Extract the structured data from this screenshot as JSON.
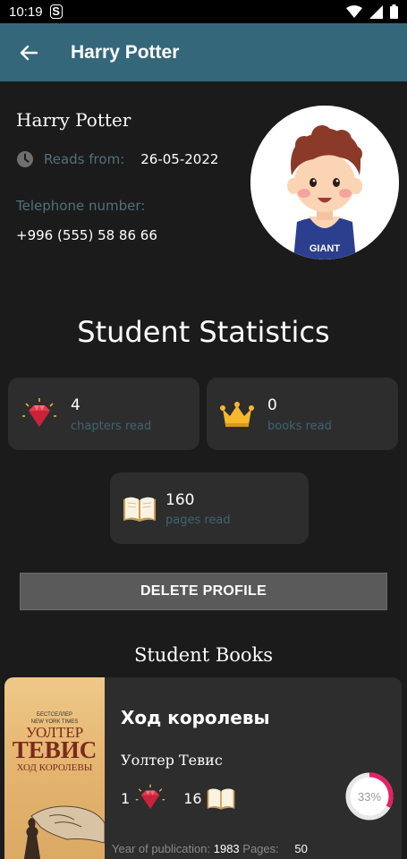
{
  "status_bar": {
    "time": "10:19",
    "sim_icon": "sim-icon",
    "icons": [
      "wifi-icon",
      "signal-icon",
      "battery-icon"
    ]
  },
  "app_bar": {
    "title": "Harry Potter",
    "background": "#35677a"
  },
  "profile": {
    "name": "Harry Potter",
    "reads_from_label": "Reads from:",
    "reads_from_value": "26-05-2022",
    "telephone_label": "Telephone number:",
    "telephone_value": "+996 (555) 58 86 66"
  },
  "stats": {
    "title": "Student Statistics",
    "cards": [
      {
        "value": "4",
        "label": "chapters read",
        "icon": "gem-icon"
      },
      {
        "value": "0",
        "label": "books read",
        "icon": "crown-icon"
      },
      {
        "value": "160",
        "label": "pages read",
        "icon": "open-book-icon"
      }
    ]
  },
  "delete_button": "DELETE PROFILE",
  "books": {
    "title": "Student Books",
    "items": [
      {
        "cover": {
          "small": "БЕСТСЕЛЛЕР\nNEW YORK TIMES",
          "author": "УОЛТЕР",
          "title": "ТЕВИС",
          "subtitle": "ХОД КОРОЛЕВЫ"
        },
        "title": "Ход королевы",
        "author": "Уолтер Тевис",
        "chapters": "1",
        "pages": "16",
        "progress_text": "33%",
        "progress": 0.33,
        "progress_color": "#e91e63",
        "year_label": "Year of publication:",
        "year": "1983",
        "pages_label": "Pages:",
        "total_pages": "50"
      }
    ]
  }
}
